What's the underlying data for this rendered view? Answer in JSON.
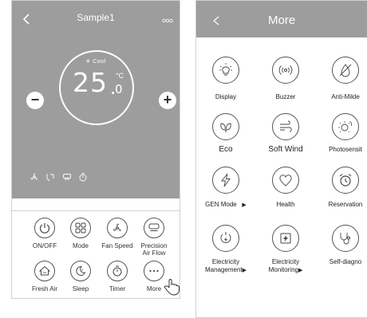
{
  "main_screen": {
    "title": "Sample1",
    "mode": "✳ Cool",
    "temperature_int": "25",
    "temperature_dec": "0",
    "unit": "°C",
    "minus": "−",
    "plus": "+",
    "controls": [
      {
        "label": "ON/OFF",
        "icon": "power-icon"
      },
      {
        "label": "Mode",
        "icon": "mode-icon"
      },
      {
        "label": "Fan Speed",
        "icon": "fan-icon"
      },
      {
        "label": "Precision Air Flow",
        "line1": "Precision",
        "line2": "Air Flow",
        "icon": "airflow-icon"
      },
      {
        "label": "Fresh Air",
        "icon": "fresh-air-icon"
      },
      {
        "label": "Sleep",
        "icon": "sleep-icon"
      },
      {
        "label": "Timer",
        "icon": "timer-icon"
      },
      {
        "label": "More",
        "icon": "more-icon"
      }
    ]
  },
  "more_screen": {
    "title": "More",
    "items": [
      {
        "label": "Display",
        "icon": "bulb-icon"
      },
      {
        "label": "Buzzer",
        "icon": "buzzer-icon"
      },
      {
        "label": "Anti-Milde",
        "icon": "anti-mildew-icon"
      },
      {
        "label": "Eco",
        "icon": "leaf-icon"
      },
      {
        "label": "Soft Wind",
        "icon": "wind-icon"
      },
      {
        "label": "Photosensit",
        "icon": "sun-icon"
      },
      {
        "label": "GEN Mode",
        "icon": "lightning-icon"
      },
      {
        "label": "Health",
        "icon": "heart-icon"
      },
      {
        "label": "Reservation",
        "icon": "alarm-icon"
      },
      {
        "label": "Electricity Management",
        "line1": "Electricity",
        "line2": "Management",
        "icon": "electricity-management-icon"
      },
      {
        "label": "Electricity Monitoring",
        "line1": "Electricity",
        "line2": "Monitoring",
        "icon": "electricity-monitoring-icon"
      },
      {
        "label": "Self-diagno",
        "icon": "stethoscope-icon"
      }
    ],
    "arrow": "▶"
  }
}
